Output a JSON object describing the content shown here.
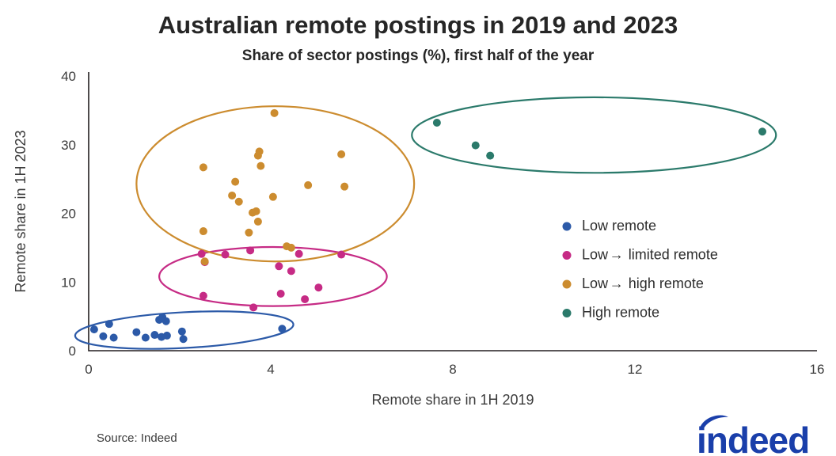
{
  "chart_data": {
    "type": "scatter",
    "title": "Australian remote postings in 2019 and 2023",
    "subtitle": "Share of sector postings (%), first half of the year",
    "xlabel": "Remote share in 1H 2019",
    "ylabel": "Remote share in 1H 2023",
    "xlim": [
      0,
      16
    ],
    "ylim": [
      0,
      40
    ],
    "xticks": [
      0,
      4,
      8,
      12,
      16
    ],
    "yticks": [
      0,
      10,
      20,
      30,
      40
    ],
    "xtick_labels": [
      "0",
      "4",
      "8",
      "12",
      "16"
    ],
    "ytick_labels": [
      "0",
      "10",
      "20",
      "30",
      "40"
    ],
    "grid": false,
    "legend_position": "right",
    "source": "Source: Indeed",
    "logo_text": "indeed",
    "series": [
      {
        "name": "Low remote",
        "color": "#2c5aa8",
        "points": [
          [
            0.12,
            3.1
          ],
          [
            0.45,
            3.9
          ],
          [
            0.32,
            2.1
          ],
          [
            0.55,
            1.9
          ],
          [
            1.05,
            2.7
          ],
          [
            1.25,
            1.9
          ],
          [
            1.55,
            4.5
          ],
          [
            1.62,
            4.9
          ],
          [
            1.7,
            4.3
          ],
          [
            1.45,
            2.3
          ],
          [
            1.6,
            2.0
          ],
          [
            1.72,
            2.2
          ],
          [
            2.05,
            2.8
          ],
          [
            2.08,
            1.7
          ],
          [
            4.25,
            3.2
          ]
        ]
      },
      {
        "name": "Low → limited remote",
        "color": "#c62b85",
        "points": [
          [
            2.48,
            14.1
          ],
          [
            2.55,
            12.9
          ],
          [
            2.52,
            8.0
          ],
          [
            3.0,
            14.0
          ],
          [
            3.55,
            14.6
          ],
          [
            3.62,
            6.3
          ],
          [
            4.18,
            12.3
          ],
          [
            4.22,
            8.3
          ],
          [
            4.45,
            11.6
          ],
          [
            4.62,
            14.1
          ],
          [
            4.75,
            7.5
          ],
          [
            5.05,
            9.2
          ],
          [
            5.55,
            14.0
          ]
        ]
      },
      {
        "name": "Low → high remote",
        "color": "#cc8c2f",
        "points": [
          [
            2.52,
            26.7
          ],
          [
            2.52,
            17.4
          ],
          [
            2.55,
            13.0
          ],
          [
            3.15,
            22.6
          ],
          [
            3.22,
            24.6
          ],
          [
            3.3,
            21.7
          ],
          [
            3.72,
            28.4
          ],
          [
            3.75,
            29.0
          ],
          [
            3.78,
            26.9
          ],
          [
            3.52,
            17.2
          ],
          [
            3.6,
            20.1
          ],
          [
            3.68,
            20.3
          ],
          [
            3.72,
            18.8
          ],
          [
            4.08,
            34.6
          ],
          [
            4.05,
            22.4
          ],
          [
            4.35,
            15.2
          ],
          [
            4.45,
            15.0
          ],
          [
            4.82,
            24.1
          ],
          [
            5.55,
            28.6
          ],
          [
            5.62,
            23.9
          ]
        ]
      },
      {
        "name": "High remote",
        "color": "#2b7a6b",
        "points": [
          [
            7.65,
            33.2
          ],
          [
            8.5,
            29.9
          ],
          [
            8.82,
            28.4
          ],
          [
            14.8,
            31.9
          ]
        ]
      }
    ],
    "clusters": [
      {
        "name": "Low remote",
        "color": "#2c5aa8",
        "cx": 2.1,
        "cy": 3.0,
        "rx": 2.4,
        "ry": 2.6,
        "rotation": -3
      },
      {
        "name": "Low → limited remote",
        "color": "#c62b85",
        "cx": 4.05,
        "cy": 10.8,
        "rx": 2.5,
        "ry": 4.3,
        "rotation": 0
      },
      {
        "name": "Low → high remote",
        "color": "#cc8c2f",
        "cx": 4.1,
        "cy": 24.3,
        "rx": 3.05,
        "ry": 11.3,
        "rotation": 0
      },
      {
        "name": "High remote",
        "color": "#2b7a6b",
        "cx": 11.1,
        "cy": 31.4,
        "rx": 4.0,
        "ry": 5.5,
        "rotation": 0
      }
    ],
    "legend": [
      {
        "label_before": "Low remote",
        "has_arrow": false,
        "label_after": "",
        "color": "#2c5aa8"
      },
      {
        "label_before": "Low",
        "has_arrow": true,
        "label_after": "limited remote",
        "color": "#c62b85"
      },
      {
        "label_before": "Low",
        "has_arrow": true,
        "label_after": "high remote",
        "color": "#cc8c2f"
      },
      {
        "label_before": "High remote",
        "has_arrow": false,
        "label_after": "",
        "color": "#2b7a6b"
      }
    ]
  }
}
